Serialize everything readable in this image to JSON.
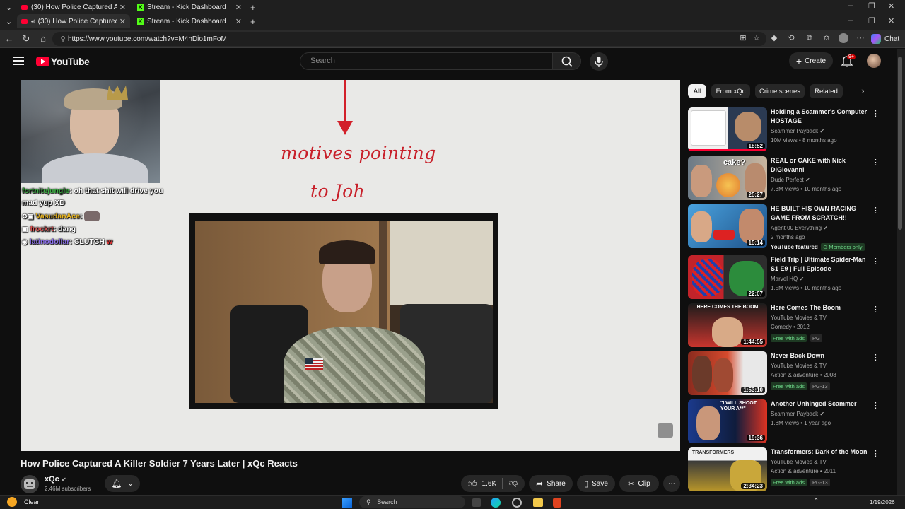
{
  "browser": {
    "tabs": [
      {
        "label": "(30) How Police Captured A Kil",
        "favicon": "youtube-icon"
      },
      {
        "label": "Stream - Kick Dashboard",
        "favicon": "kick-icon"
      }
    ],
    "tabs_row2": [
      {
        "label": "(30) How Police Captured A Kil",
        "favicon": "youtube-icon"
      },
      {
        "label": "Stream - Kick Dashboard",
        "favicon": "kick-icon"
      }
    ],
    "url": "https://www.youtube.com/watch?v=M4hDio1mFoM",
    "chat_label": "Chat"
  },
  "youtube": {
    "logo_text": "YouTube",
    "search_placeholder": "Search",
    "create_label": "Create",
    "notification_count": "9+"
  },
  "video": {
    "overlay_text_line1": "motives pointing",
    "overlay_text_line2": "to Joh",
    "chat": [
      {
        "user": "fortnitejungle",
        "msg": "oh that shit will drive you",
        "user_color": "#3cb043"
      },
      {
        "user": "",
        "msg": "mad yup XD",
        "user_color": "#ffffff"
      },
      {
        "user": "VasudanAce",
        "msg": "",
        "user_color": "#e6b422"
      },
      {
        "user": "frockrt",
        "msg": "dang",
        "user_color": "#e05555"
      },
      {
        "user": "latinodollar",
        "msg": "CLUTCH",
        "user_color": "#8a6fe8",
        "suffix": "w"
      }
    ],
    "title": "How Police Captured A Killer Soldier 7 Years Later | xQc Reacts",
    "channel": "xQc",
    "subscribers": "2.46M subscribers",
    "likes": "1.6K",
    "share_label": "Share",
    "save_label": "Save",
    "clip_label": "Clip"
  },
  "chips": [
    "All",
    "From xQc",
    "Crime scenes",
    "Related"
  ],
  "recommendations": [
    {
      "title": "Holding a Scammer's Computer HOSTAGE",
      "channel": "Scammer Payback",
      "meta": "10M views • 8 months ago",
      "duration": "18:52",
      "verified": true
    },
    {
      "title": "REAL or CAKE with Nick DiGiovanni",
      "channel": "Dude Perfect",
      "meta": "7.3M views • 10 months ago",
      "duration": "25:27",
      "verified": true
    },
    {
      "title": "HE BUILT HIS OWN RACING GAME FROM SCRATCH!!",
      "channel": "Agent 00 Everything",
      "meta": "2 months ago",
      "duration": "15:14",
      "verified": true,
      "badge": "YouTube featured",
      "badge2": "Members only"
    },
    {
      "title": "Field Trip | Ultimate Spider-Man S1 E9 | Full Episode",
      "channel": "Marvel HQ",
      "meta": "1.5M views • 10 months ago",
      "duration": "22:07",
      "verified": true
    },
    {
      "title": "Here Comes The Boom",
      "channel": "YouTube Movies & TV",
      "meta": "Comedy • 2012",
      "duration": "1:44:55",
      "badge": "Free with ads",
      "badge2": "PG"
    },
    {
      "title": "Never Back Down",
      "channel": "YouTube Movies & TV",
      "meta": "Action & adventure • 2008",
      "duration": "1:53:10",
      "badge": "Free with ads",
      "badge2": "PG-13"
    },
    {
      "title": "Another Unhinged Scammer",
      "channel": "Scammer Payback",
      "meta": "1.8M views • 1 year ago",
      "duration": "19:36",
      "verified": true
    },
    {
      "title": "Transformers: Dark of the Moon",
      "channel": "YouTube Movies & TV",
      "meta": "Action & adventure • 2011",
      "duration": "2:34:23",
      "badge": "Free with ads",
      "badge2": "PG-13"
    }
  ],
  "thumb_texts": {
    "t2": "cake?",
    "t5": "HERE COMES THE BOOM",
    "t7": "\"I WILL SHOOT YOUR A**\"",
    "t8": "TRANSFORMERS"
  },
  "taskbar": {
    "weather": "Clear",
    "search": "Search",
    "date": "1/19/2026"
  }
}
